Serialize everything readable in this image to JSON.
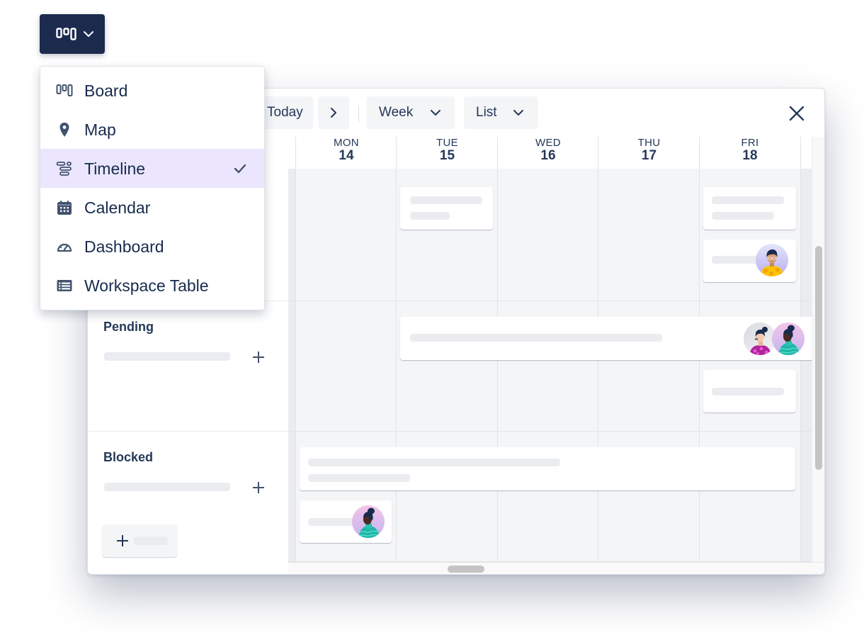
{
  "view_switcher": {
    "current_icon": "board-icon",
    "chevron": "chevron-down-icon"
  },
  "menu": {
    "items": [
      {
        "label": "Board",
        "icon": "board-icon"
      },
      {
        "label": "Map",
        "icon": "map-pin-icon"
      },
      {
        "label": "Timeline",
        "icon": "timeline-icon",
        "selected": true
      },
      {
        "label": "Calendar",
        "icon": "calendar-icon"
      },
      {
        "label": "Dashboard",
        "icon": "dashboard-icon"
      },
      {
        "label": "Workspace Table",
        "icon": "table-icon"
      }
    ],
    "selected": "Timeline"
  },
  "toolbar": {
    "today_label": "Today",
    "next_icon": "chevron-right-icon",
    "range_label": "Week",
    "group_label": "List",
    "close_icon": "close-icon"
  },
  "days": [
    {
      "dow": "MON",
      "date": "14"
    },
    {
      "dow": "TUE",
      "date": "15"
    },
    {
      "dow": "WED",
      "date": "16"
    },
    {
      "dow": "THU",
      "date": "17"
    },
    {
      "dow": "FRI",
      "date": "18"
    }
  ],
  "rows": [
    {
      "label": "Pending"
    },
    {
      "label": "Blocked"
    }
  ],
  "avatars": {
    "fri_top": "avatar-person-yellow-shirt",
    "pending_1": "avatar-person-magenta-shirt",
    "pending_2": "avatar-person-teal-turtleneck",
    "blocked_mon": "avatar-person-teal-turtleneck"
  },
  "colors": {
    "trigger_bg": "#1c2a4e",
    "selected_item_bg": "#ebe6fd",
    "grid_bg": "#f4f5f7",
    "text": "#172b4d"
  }
}
